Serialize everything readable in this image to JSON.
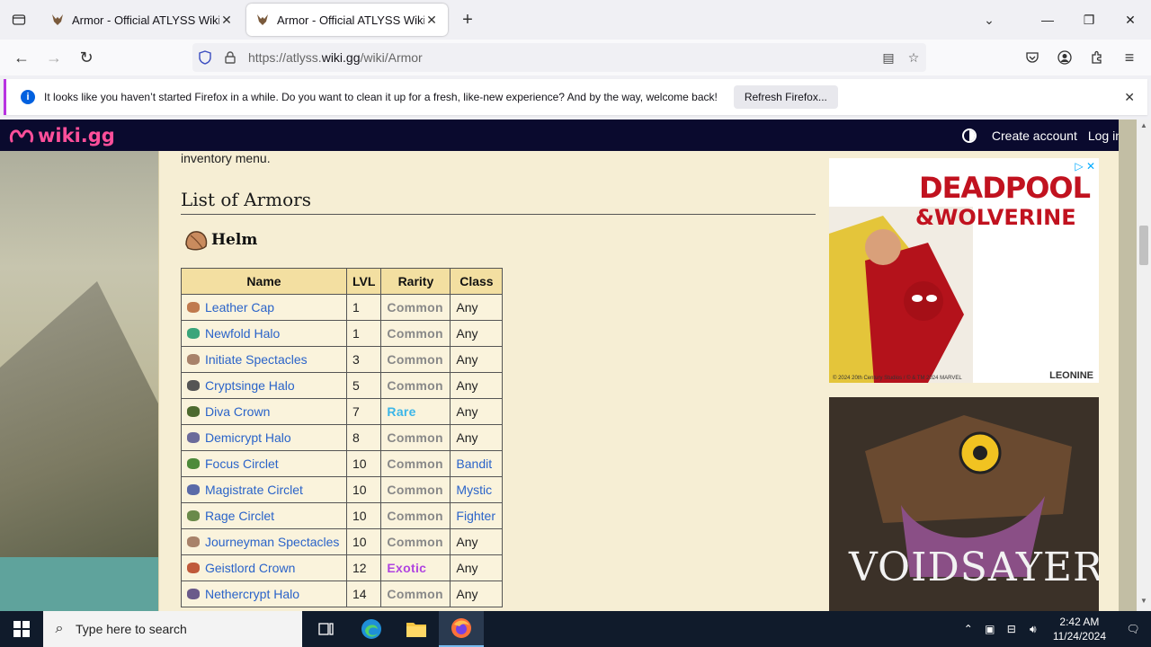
{
  "browser": {
    "tabs": [
      {
        "title": "Armor - Official ATLYSS Wiki",
        "active": false
      },
      {
        "title": "Armor - Official ATLYSS Wiki",
        "active": true
      }
    ],
    "url_prefix": "https://atlyss.",
    "url_domain": "wiki.gg",
    "url_suffix": "/wiki/Armor"
  },
  "notification": {
    "message": "It looks like you haven’t started Firefox in a while. Do you want to clean it up for a fresh, like-new experience? And by the way, welcome back!",
    "button": "Refresh Firefox..."
  },
  "wiki": {
    "logo": "wiki.gg",
    "create_account": "Create account",
    "log_in": "Log in"
  },
  "article": {
    "intro_tail": "inventory menu.",
    "section_title": "List of Armors",
    "subsection_title": "Helm",
    "table": {
      "headers": [
        "Name",
        "LVL",
        "Rarity",
        "Class"
      ],
      "rows": [
        {
          "name": "Leather Cap",
          "lvl": "1",
          "rarity": "Common",
          "class": "Any"
        },
        {
          "name": "Newfold Halo",
          "lvl": "1",
          "rarity": "Common",
          "class": "Any"
        },
        {
          "name": "Initiate Spectacles",
          "lvl": "3",
          "rarity": "Common",
          "class": "Any"
        },
        {
          "name": "Cryptsinge Halo",
          "lvl": "5",
          "rarity": "Common",
          "class": "Any"
        },
        {
          "name": "Diva Crown",
          "lvl": "7",
          "rarity": "Rare",
          "class": "Any"
        },
        {
          "name": "Demicrypt Halo",
          "lvl": "8",
          "rarity": "Common",
          "class": "Any"
        },
        {
          "name": "Focus Circlet",
          "lvl": "10",
          "rarity": "Common",
          "class": "Bandit"
        },
        {
          "name": "Magistrate Circlet",
          "lvl": "10",
          "rarity": "Common",
          "class": "Mystic"
        },
        {
          "name": "Rage Circlet",
          "lvl": "10",
          "rarity": "Common",
          "class": "Fighter"
        },
        {
          "name": "Journeyman Spectacles",
          "lvl": "10",
          "rarity": "Common",
          "class": "Any"
        },
        {
          "name": "Geistlord Crown",
          "lvl": "12",
          "rarity": "Exotic",
          "class": "Any"
        },
        {
          "name": "Nethercrypt Halo",
          "lvl": "14",
          "rarity": "Common",
          "class": "Any"
        }
      ]
    }
  },
  "colors": {
    "rarity_common": "#888888",
    "rarity_rare": "#3cb6e8",
    "rarity_exotic": "#b044e0",
    "link": "#2a63c9",
    "wiki_header": "#0a0a2e",
    "wiki_logo": "#ff4f9a"
  },
  "ads": {
    "ad1_title_line1": "DEADPOOL",
    "ad1_title_line2": "&WOLVERINE",
    "ad1_brand": "LEONINE",
    "ad1_copy": "© 2024 20th Century Studios / © & TM 2024 MARVEL",
    "ad2_title": "VOIDSAYER"
  },
  "taskbar": {
    "search_placeholder": "Type here to search",
    "time": "2:42 AM",
    "date": "11/24/2024"
  }
}
